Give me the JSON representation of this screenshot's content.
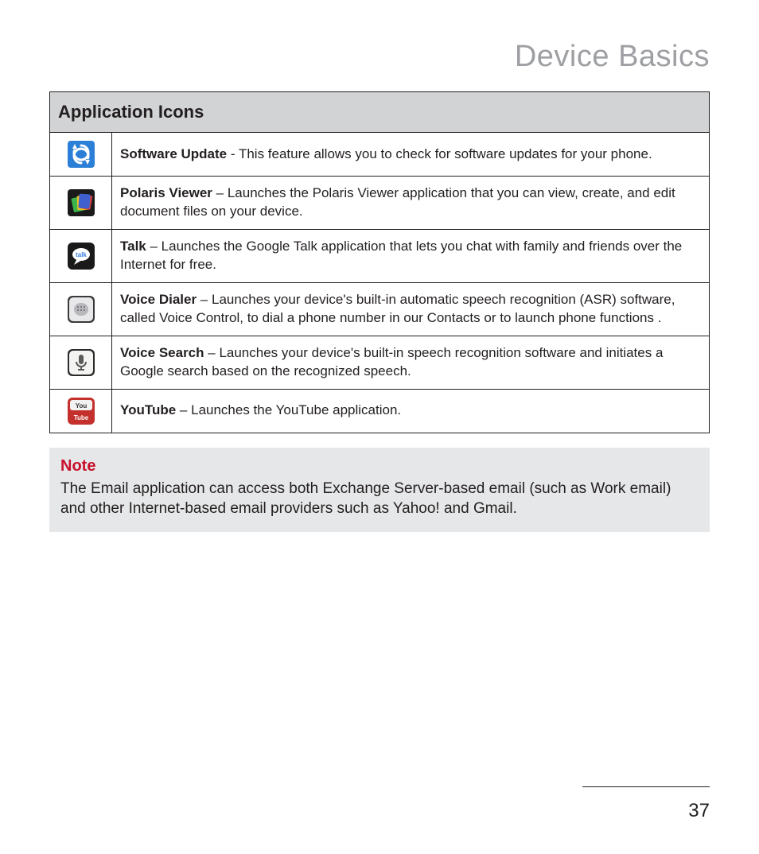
{
  "page_title": "Device Basics",
  "table_header": "Application Icons",
  "rows": [
    {
      "icon": "software-update-icon",
      "name": "Software Update",
      "sep": " - ",
      "desc": "This feature allows you to check for software updates for your phone."
    },
    {
      "icon": "polaris-viewer-icon",
      "name": "Polaris Viewer",
      "sep": " – ",
      "desc": "Launches the Polaris Viewer application that you can view, create, and edit document files on your device."
    },
    {
      "icon": "talk-icon",
      "name": "Talk",
      "sep": " – ",
      "desc": "Launches the Google Talk application that lets you chat with family and friends over the Internet for free."
    },
    {
      "icon": "voice-dialer-icon",
      "name": "Voice Dialer",
      "sep": " – ",
      "desc": "Launches your device's built-in automatic speech recognition (ASR) software, called Voice Control, to dial a phone number in our Contacts or to launch phone functions ."
    },
    {
      "icon": "voice-search-icon",
      "name": "Voice Search",
      "sep": " – ",
      "desc": "Launches your device's built-in speech recognition software and initiates a Google search based on the recognized speech."
    },
    {
      "icon": "youtube-icon",
      "name": "YouTube",
      "sep": " – ",
      "desc": "Launches the YouTube application."
    }
  ],
  "note": {
    "title": "Note",
    "body": "The Email application can access both Exchange Server-based email (such as Work email) and other Internet-based email providers such as Yahoo! and Gmail."
  },
  "page_number": "37"
}
